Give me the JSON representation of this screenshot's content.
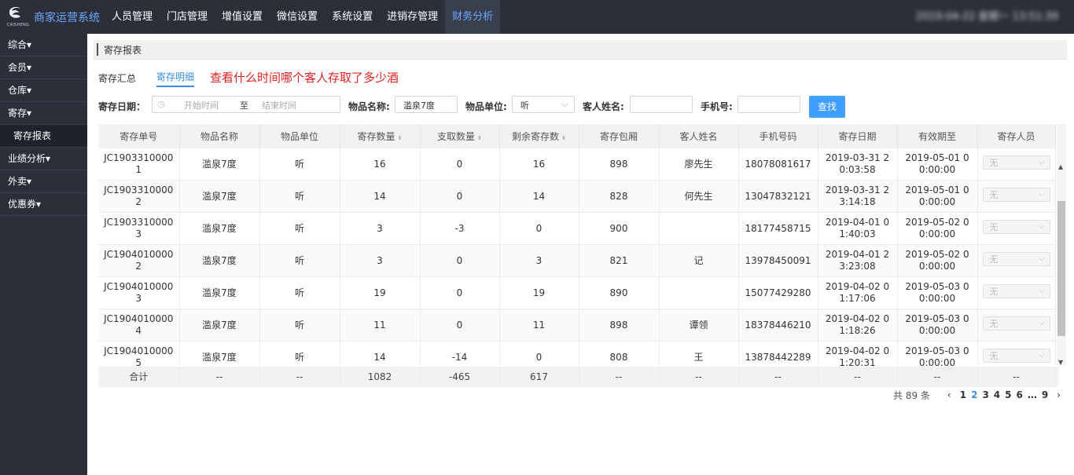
{
  "header": {
    "logo_sub": "CAISHENG",
    "app_title": "商家运营系统",
    "nav": [
      "人员管理",
      "门店管理",
      "增值设置",
      "微信设置",
      "系统设置",
      "进销存管理",
      "财务分析"
    ],
    "active_nav": 6,
    "datetime": "2019-04-22  星期一  13:51:39"
  },
  "sidebar": {
    "items": [
      {
        "label": "综合▾",
        "sub": false
      },
      {
        "label": "会员▾",
        "sub": false
      },
      {
        "label": "仓库▾",
        "sub": false
      },
      {
        "label": "寄存▾",
        "sub": false
      },
      {
        "label": "寄存报表",
        "sub": true
      },
      {
        "label": "业绩分析▾",
        "sub": false
      },
      {
        "label": "外卖▾",
        "sub": false
      },
      {
        "label": "优惠券▾",
        "sub": false
      }
    ]
  },
  "breadcrumb": "寄存报表",
  "tabs": [
    "寄存汇总",
    "寄存明细"
  ],
  "annotation": "查看什么时间哪个客人存取了多少酒",
  "filters": {
    "date_label": "寄存日期：",
    "start_placeholder": "开始时间",
    "sep": "至",
    "end_placeholder": "结束时间",
    "name_label": "物品名称:",
    "name_value": "滥泉7度",
    "unit_label": "物品单位:",
    "unit_value": "听",
    "customer_label": "客人姓名:",
    "phone_label": "手机号:",
    "search_label": "查找"
  },
  "table": {
    "headers": [
      "寄存单号",
      "物品名称",
      "物品单位",
      "寄存数量",
      "支取数量",
      "剩余寄存数",
      "寄存包厢",
      "客人姓名",
      "手机号码",
      "寄存日期",
      "有效期至",
      "寄存人员"
    ],
    "sortable": [
      3,
      4,
      5
    ],
    "rows": [
      {
        "id": [
          "JC1903310000",
          "1"
        ],
        "name": "滥泉7度",
        "unit": "听",
        "dep": "16",
        "wd": "0",
        "rem": "16",
        "room": "898",
        "cust": "廖先生",
        "phone": "18078081617",
        "date": [
          "2019-03-31 2",
          "0:03:58"
        ],
        "exp": [
          "2019-05-01 0",
          "0:00:00"
        ],
        "staff": "无"
      },
      {
        "id": [
          "JC1903310000",
          "2"
        ],
        "name": "滥泉7度",
        "unit": "听",
        "dep": "14",
        "wd": "0",
        "rem": "14",
        "room": "828",
        "cust": "何先生",
        "phone": "13047832121",
        "date": [
          "2019-03-31 2",
          "3:14:18"
        ],
        "exp": [
          "2019-05-01 0",
          "0:00:00"
        ],
        "staff": "无"
      },
      {
        "id": [
          "JC1903310000",
          "3"
        ],
        "name": "滥泉7度",
        "unit": "听",
        "dep": "3",
        "wd": "-3",
        "rem": "0",
        "room": "900",
        "cust": "",
        "phone": "18177458715",
        "date": [
          "2019-04-01 0",
          "1:40:03"
        ],
        "exp": [
          "2019-05-02 0",
          "0:00:00"
        ],
        "staff": "无"
      },
      {
        "id": [
          "JC1904010000",
          "2"
        ],
        "name": "滥泉7度",
        "unit": "听",
        "dep": "3",
        "wd": "0",
        "rem": "3",
        "room": "821",
        "cust": "记",
        "phone": "13978450091",
        "date": [
          "2019-04-01 2",
          "3:23:08"
        ],
        "exp": [
          "2019-05-02 0",
          "0:00:00"
        ],
        "staff": "无"
      },
      {
        "id": [
          "JC1904010000",
          "3"
        ],
        "name": "滥泉7度",
        "unit": "听",
        "dep": "19",
        "wd": "0",
        "rem": "19",
        "room": "890",
        "cust": "",
        "phone": "15077429280",
        "date": [
          "2019-04-02 0",
          "1:17:06"
        ],
        "exp": [
          "2019-05-03 0",
          "0:00:00"
        ],
        "staff": "无"
      },
      {
        "id": [
          "JC1904010000",
          "4"
        ],
        "name": "滥泉7度",
        "unit": "听",
        "dep": "11",
        "wd": "0",
        "rem": "11",
        "room": "898",
        "cust": "谭领",
        "phone": "18378446210",
        "date": [
          "2019-04-02 0",
          "1:18:26"
        ],
        "exp": [
          "2019-05-03 0",
          "0:00:00"
        ],
        "staff": "无"
      },
      {
        "id": [
          "JC1904010000",
          "5"
        ],
        "name": "滥泉7度",
        "unit": "听",
        "dep": "14",
        "wd": "-14",
        "rem": "0",
        "room": "808",
        "cust": "王",
        "phone": "13878442289",
        "date": [
          "2019-04-02 0",
          "1:20:31"
        ],
        "exp": [
          "2019-05-03 0",
          "0:00:00"
        ],
        "staff": "无"
      }
    ],
    "totals": [
      "合计",
      "--",
      "--",
      "1082",
      "-465",
      "617",
      "--",
      "--",
      "--",
      "--",
      "--",
      "--"
    ]
  },
  "pager": {
    "total": "共 89 条",
    "pages": [
      "1",
      "2",
      "3",
      "4",
      "5",
      "6",
      "…",
      "9"
    ],
    "current": 1
  }
}
